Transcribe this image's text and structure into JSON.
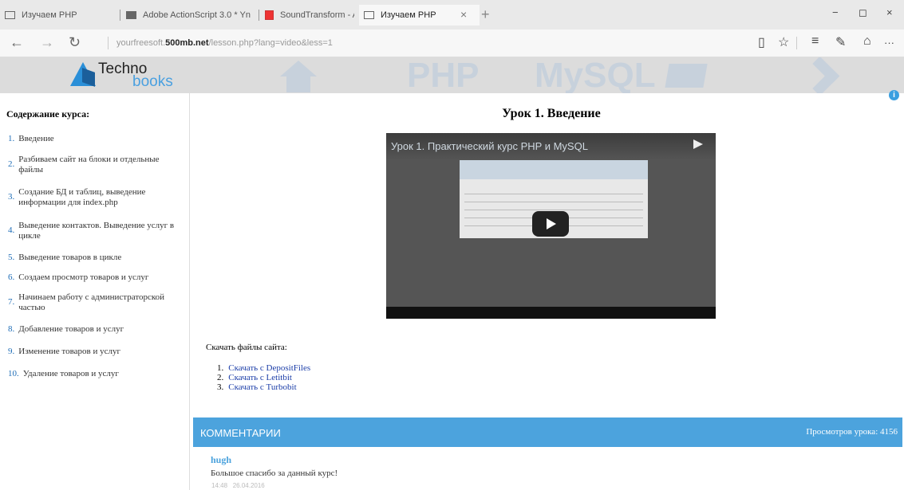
{
  "browser": {
    "tabs": [
      {
        "title": "Изучаем PHP"
      },
      {
        "title": "Adobe ActionScript 3.0 * Yn"
      },
      {
        "title": "SoundTransform - Adobe Ac"
      },
      {
        "title": "Изучаем PHP"
      }
    ],
    "tab_close": "×",
    "new_tab": "+",
    "window": {
      "minimize": "−",
      "maximize": "◻",
      "close": "×"
    },
    "nav": {
      "back": "←",
      "forward": "→",
      "refresh": "↻"
    },
    "address": {
      "prefix": "yourfreesoft.",
      "domain": "500mb.net",
      "path": "/lesson.php?lang=video&less=1"
    },
    "toolbar": {
      "reading": "▯",
      "favorite": "☆",
      "hub": "≡",
      "note": "✎",
      "share": "⌂",
      "more": "···"
    }
  },
  "banner": {
    "logo_line1": "Techno",
    "logo_line2": "books",
    "word1": "PHP",
    "word2": "MySQL",
    "info": "i"
  },
  "sidebar": {
    "title": "Содержание курса:",
    "items": [
      {
        "num": "1.",
        "label": "Введение"
      },
      {
        "num": "2.",
        "label": "Разбиваем сайт на блоки и отдельные файлы"
      },
      {
        "num": "3.",
        "label": "Создание БД и таблиц, выведение информации для index.php"
      },
      {
        "num": "4.",
        "label": "Выведение контактов. Выведение услуг в цикле"
      },
      {
        "num": "5.",
        "label": "Выведение товаров в цикле"
      },
      {
        "num": "6.",
        "label": "Создаем просмотр товаров и услуг"
      },
      {
        "num": "7.",
        "label": "Начинаем работу с администраторской частью"
      },
      {
        "num": "8.",
        "label": "Добавление товаров и услуг"
      },
      {
        "num": "9.",
        "label": "Изменение товаров и услуг"
      },
      {
        "num": "10.",
        "label": "Удаление товаров и услуг"
      }
    ]
  },
  "main": {
    "title": "Урок 1. Введение",
    "video_title": "Урок 1. Практический курс PHP и MySQL",
    "downloads_title": "Скачать файлы сайта:",
    "downloads": [
      {
        "num": "1.",
        "label": "Скачать с DepositFiles"
      },
      {
        "num": "2.",
        "label": "Скачать с Letitbit"
      },
      {
        "num": "3.",
        "label": "Скачать с Turbobit"
      }
    ]
  },
  "comments": {
    "header": "КОММЕНТАРИИ",
    "views": "Просмотров урока: 4156",
    "items": [
      {
        "author": "hugh",
        "text": "Большое спасибо за данный курс!",
        "time": "14:48",
        "date": "26.04.2016"
      }
    ]
  },
  "colors": {
    "accent": "#4ca3dd",
    "link": "#1c3ea8"
  }
}
